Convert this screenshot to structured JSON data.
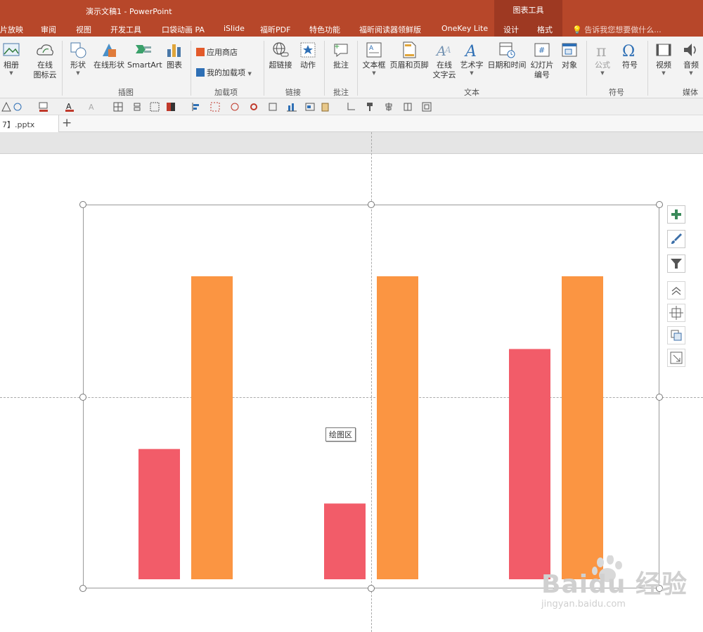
{
  "title_bar": {
    "title": "演示文稿1 - PowerPoint",
    "context_tool": "图表工具"
  },
  "tabs": [
    "片放映",
    "审阅",
    "视图",
    "开发工具",
    "口袋动画 PA",
    "iSlide",
    "福昕PDF",
    "特色功能",
    "福昕阅读器领鲜版",
    "OneKey Lite",
    "设计",
    "格式"
  ],
  "tell_me": "告诉我您想要做什么...",
  "ribbon": {
    "buttons": {
      "album": "相册",
      "online_icons_1": "在线",
      "online_icons_2": "图标云",
      "shapes": "形状",
      "online_shapes": "在线形状",
      "smartart": "SmartArt",
      "chart": "图表",
      "app_store": "应用商店",
      "my_addins": "我的加载项",
      "hyperlink": "超链接",
      "action": "动作",
      "comment": "批注",
      "textbox": "文本框",
      "header_footer": "页眉和页脚",
      "online_text_1": "在线",
      "online_text_2": "文字云",
      "wordart": "艺术字",
      "datetime": "日期和时间",
      "slide_number_1": "幻灯片",
      "slide_number_2": "编号",
      "object": "对象",
      "equation": "公式",
      "symbol": "符号",
      "video": "视频",
      "audio": "音频"
    },
    "groups": {
      "illustrations": "插图",
      "addins": "加载项",
      "links": "链接",
      "comments": "批注",
      "text": "文本",
      "symbols": "符号",
      "media": "媒体"
    }
  },
  "file_tab": {
    "name": "7】.pptx",
    "new_tab": "+"
  },
  "tooltip": "绘图区",
  "watermark": {
    "brand": "Baidu 经验",
    "url": "jingyan.baidu.com"
  },
  "colors": {
    "series_1": "#f25c69",
    "series_2": "#fb9542",
    "ribbon_red": "#b7472a"
  },
  "chart_data": {
    "type": "bar",
    "categories": [
      "",
      "",
      ""
    ],
    "series": [
      {
        "values": [
          43,
          25,
          76
        ]
      },
      {
        "values": [
          100,
          100,
          100
        ]
      }
    ],
    "ylim": [
      0,
      100
    ],
    "grid": false,
    "legend": "none"
  }
}
